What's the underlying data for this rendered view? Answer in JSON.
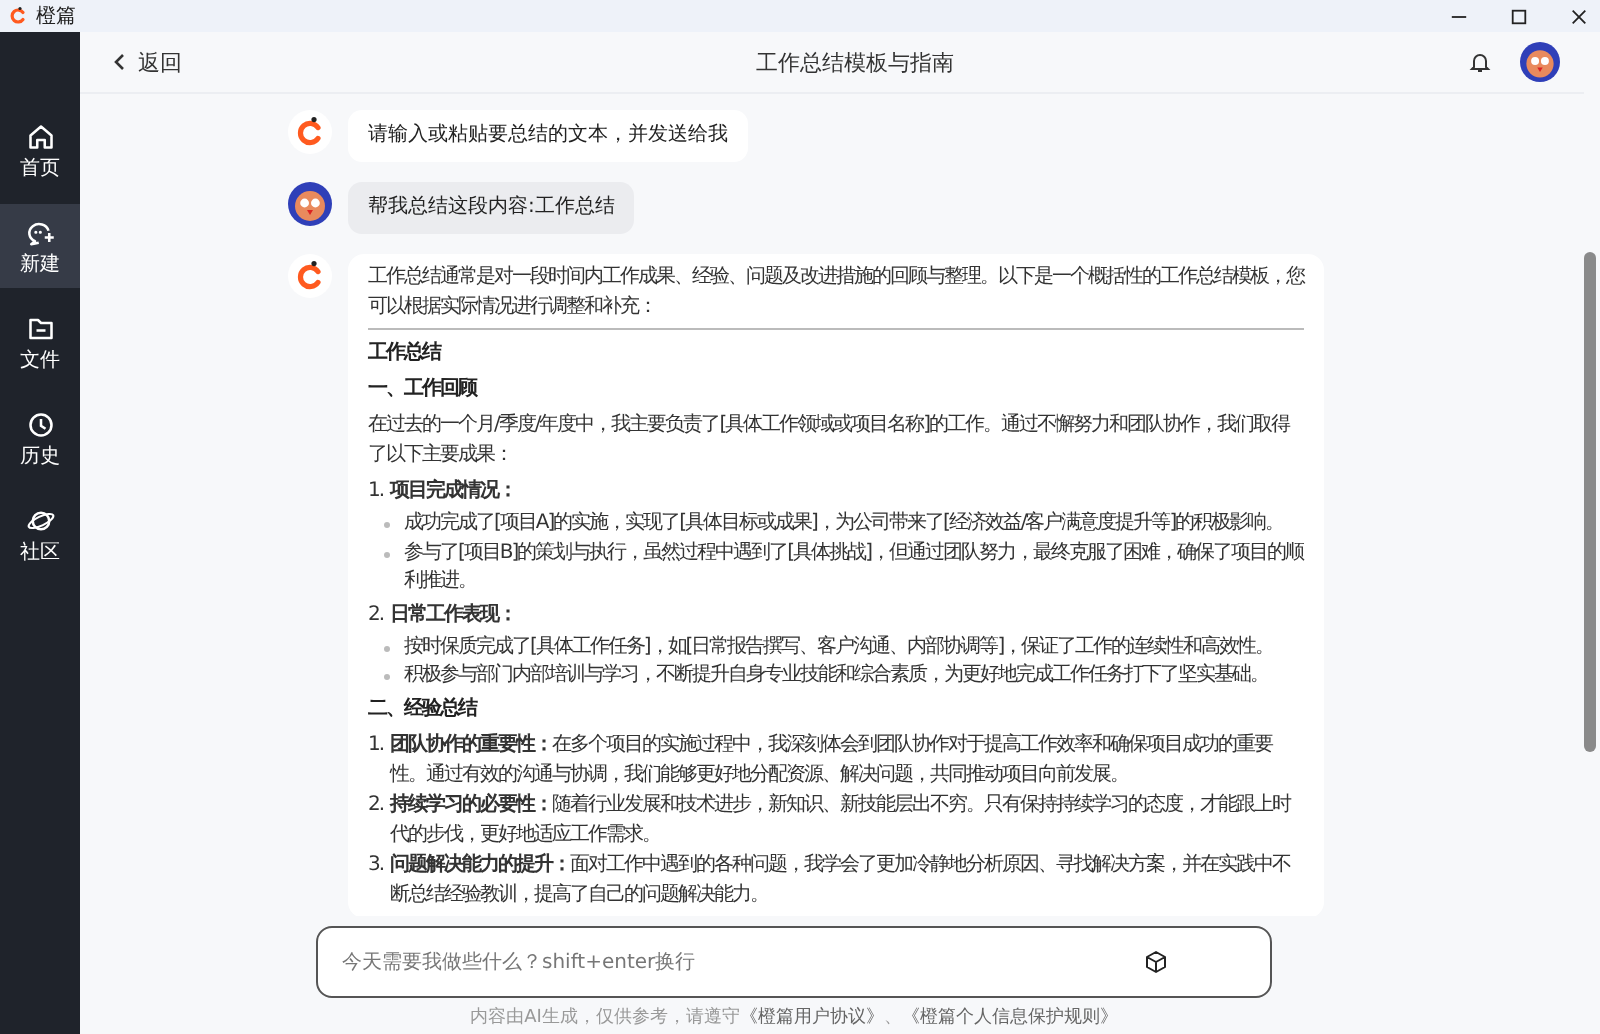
{
  "window": {
    "title": "橙篇"
  },
  "sidebar": {
    "items": [
      {
        "label": "首页",
        "selected": false
      },
      {
        "label": "新建",
        "selected": true
      },
      {
        "label": "文件",
        "selected": false
      },
      {
        "label": "历史",
        "selected": false
      },
      {
        "label": "社区",
        "selected": false
      }
    ]
  },
  "header": {
    "back_label": "返回",
    "title": "工作总结模板与指南"
  },
  "messages": [
    {
      "kind": "assistant",
      "text": "请输入或粘贴要总结的文本，并发送给我"
    },
    {
      "kind": "user",
      "text": "帮我总结这段内容:工作总结"
    },
    {
      "kind": "assistant",
      "blocks": [
        {
          "kind": "paragraph",
          "text": "工作总结通常是对一段时间内工作成果、经验、问题及改进措施的回顾与整理。以下是一个概括性的工作总结模板，您可以根据实际情况进行调整和补充："
        },
        {
          "kind": "divider"
        },
        {
          "kind": "heading",
          "text": "工作总结"
        },
        {
          "kind": "heading",
          "text": "一、工作回顾"
        },
        {
          "kind": "paragraph",
          "text": "在过去的一个月/季度/年度中，我主要负责了[具体工作领域或项目名称]的工作。通过不懈努力和团队协作，我们取得了以下主要成果："
        },
        {
          "kind": "numbered_heading",
          "number": "1.",
          "text": "项目完成情况：",
          "bullets": [
            "成功完成了[项目A]的实施，实现了[具体目标或成果]，为公司带来了[经济效益/客户满意度提升等]的积极影响。",
            "参与了[项目B]的策划与执行，虽然过程中遇到了[具体挑战]，但通过团队努力，最终克服了困难，确保了项目的顺利推进。"
          ]
        },
        {
          "kind": "numbered_heading",
          "number": "2.",
          "text": "日常工作表现：",
          "bullets": [
            "按时保质完成了[具体工作任务]，如[日常报告撰写、客户沟通、内部协调等]，保证了工作的连续性和高效性。",
            "积极参与部门内部培训与学习，不断提升自身专业技能和综合素质，为更好地完成工作任务打下了坚实基础。"
          ]
        },
        {
          "kind": "heading",
          "text": "二、经验总结"
        },
        {
          "kind": "numbered",
          "number": "1.",
          "text": "**团队协作的重要性：**在多个项目的实施过程中，我深刻体会到团队协作对于提高工作效率和确保项目成功的重要性。通过有效的沟通与协调，我们能够更好地分配资源、解决问题，共同推动项目向前发展。"
        },
        {
          "kind": "numbered",
          "number": "2.",
          "text": "**持续学习的必要性：**随着行业发展和技术进步，新知识、新技能层出不穷。只有保持持续学习的态度，才能跟上时代的步伐，更好地适应工作需求。"
        },
        {
          "kind": "numbered",
          "number": "3.",
          "text": "**问题解决能力的提升：**面对工作中遇到的各种问题，我学会了更加冷静地分析原因、寻找解决方案，并在实践中不断总结经验教训，提高了自己的问题解决能力。"
        }
      ]
    }
  ],
  "composer": {
    "placeholder": "今天需要我做些什么？shift+enter换行"
  },
  "footer": [
    {
      "kind": "text",
      "text": "内容由AI生成，仅供参考，请遵守"
    },
    {
      "kind": "link",
      "text": "《橙篇用户协议》"
    },
    {
      "kind": "text",
      "text": "、"
    },
    {
      "kind": "link",
      "text": "《橙篇个人信息保护规则》"
    }
  ]
}
